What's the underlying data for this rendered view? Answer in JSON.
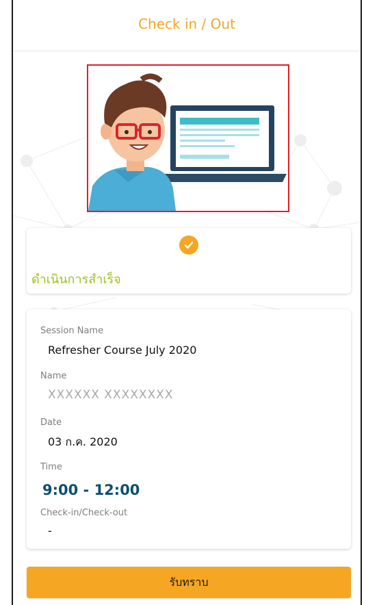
{
  "header": {
    "title": "Check in / Out"
  },
  "illustration": {
    "name": "person-with-laptop-illustration"
  },
  "status": {
    "icon": "check-circle-icon",
    "message": "ดำเนินการสำเร็จ",
    "accent_color": "#f5a623",
    "message_color": "#9bc219"
  },
  "details": {
    "session_name_label": "Session Name",
    "session_name_value": "Refresher Course July 2020",
    "name_label": "Name",
    "name_value": "XXXXXX  XXXXXXXX",
    "date_label": "Date",
    "date_value": "03 ก.ค. 2020",
    "time_label": "Time",
    "time_value": "9:00 - 12:00",
    "checkinout_label": "Check-in/Check-out",
    "checkinout_value": "-"
  },
  "actions": {
    "acknowledge_label": "รับทราบ"
  },
  "colors": {
    "header_title": "#f0a824",
    "button_bg": "#f5a623",
    "time_value": "#0d4f72",
    "illustration_border": "#e21e26"
  }
}
